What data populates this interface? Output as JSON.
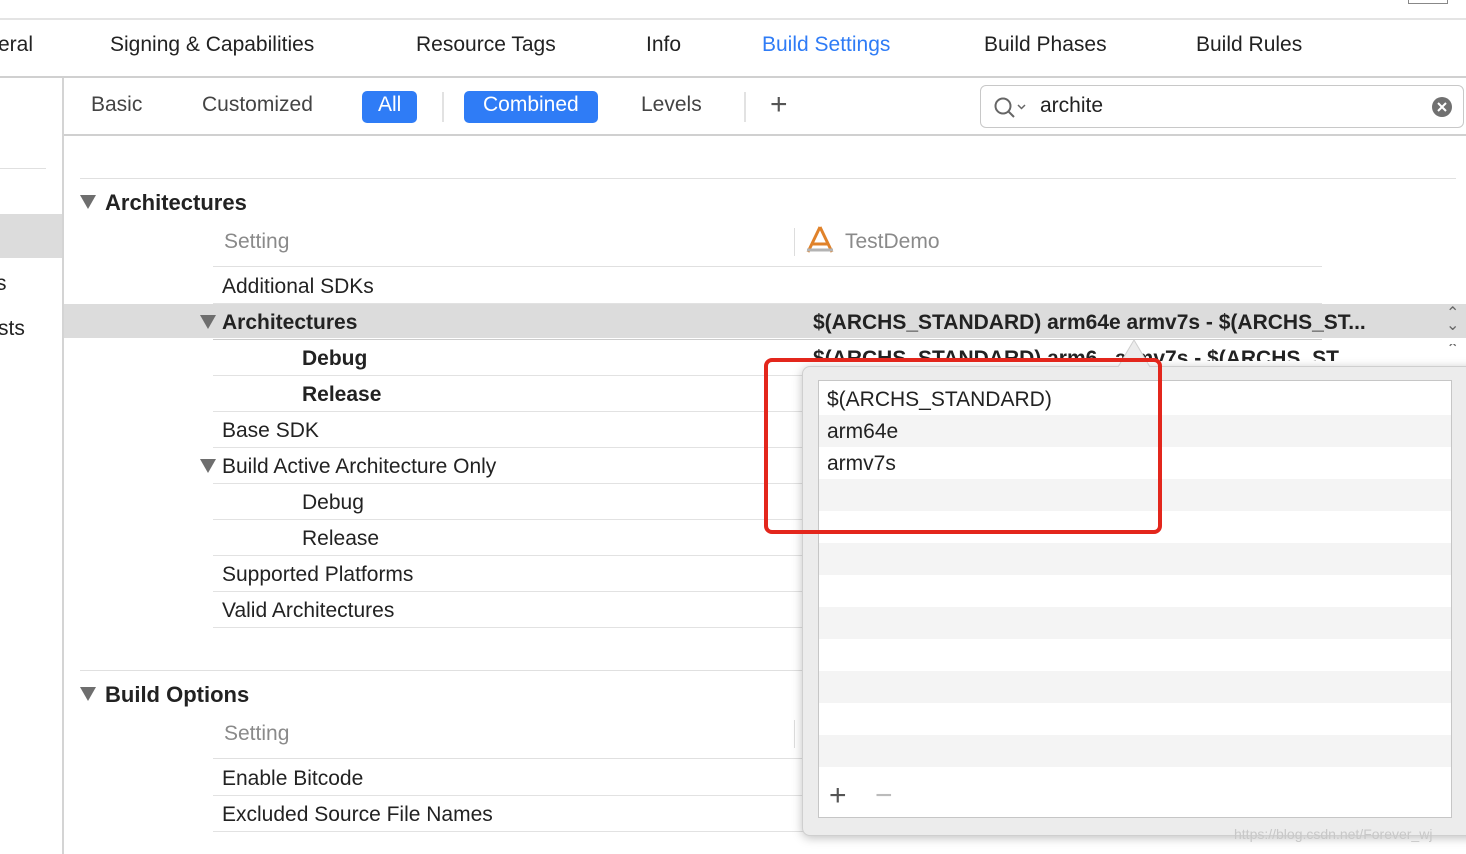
{
  "tabs": [
    {
      "label": "eral"
    },
    {
      "label": "Signing & Capabilities"
    },
    {
      "label": "Resource Tags"
    },
    {
      "label": "Info"
    },
    {
      "label": "Build Settings",
      "active": true
    },
    {
      "label": "Build Phases"
    },
    {
      "label": "Build Rules"
    }
  ],
  "sidebar": {
    "items": [
      {
        "label": "s"
      },
      {
        "label": "sts"
      }
    ]
  },
  "filters": {
    "basic": "Basic",
    "customized": "Customized",
    "all": "All",
    "combined": "Combined",
    "levels": "Levels",
    "add": "+"
  },
  "search": {
    "value": "archite"
  },
  "accent": "#2f7cf6",
  "sections": [
    {
      "title": "Architectures",
      "header_setting": "Setting",
      "header_target": "TestDemo",
      "rows": [
        {
          "label": "Additional SDKs"
        },
        {
          "label": "Architectures",
          "bold": true,
          "value": "$(ARCHS_STANDARD) arm64e armv7s  -  $(ARCHS_ST..."
        },
        {
          "label": "Debug",
          "bold": true,
          "value": "$(ARCHS_STANDARD) arm6...armv7s  -  $(ARCHS_ST..."
        },
        {
          "label": "Release",
          "bold": true
        },
        {
          "label": "Base SDK"
        },
        {
          "label": "Build Active Architecture Only"
        },
        {
          "label": "Debug"
        },
        {
          "label": "Release"
        },
        {
          "label": "Supported Platforms"
        },
        {
          "label": "Valid Architectures"
        }
      ]
    },
    {
      "title": "Build Options",
      "header_setting": "Setting",
      "rows": [
        {
          "label": "Enable Bitcode"
        },
        {
          "label": "Excluded Source File Names"
        }
      ]
    }
  ],
  "popover": {
    "items": [
      "$(ARCHS_STANDARD)",
      "arm64e",
      "armv7s"
    ],
    "add": "+",
    "remove": "−"
  },
  "highlight_color": "#e3261c",
  "watermark": "https://blog.csdn.net/Forever_wj"
}
